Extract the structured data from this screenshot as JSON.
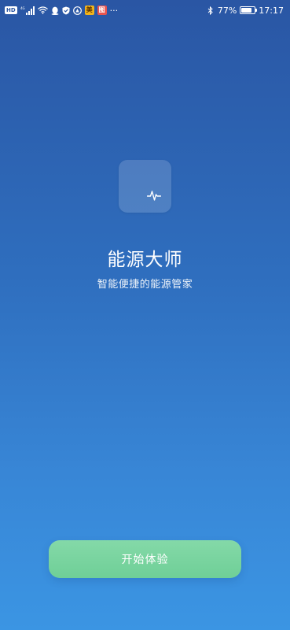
{
  "status_bar": {
    "hd_label": "HD",
    "network_label": "4G",
    "app_badge_1": "美",
    "app_badge_2": "图",
    "more_label": "···",
    "battery_percent": "77%",
    "battery_level": 0.77,
    "time": "17:17"
  },
  "app": {
    "title": "能源大师",
    "subtitle": "智能便捷的能源管家"
  },
  "actions": {
    "start_label": "开始体验"
  },
  "colors": {
    "background_top": "#2a56a4",
    "background_bottom": "#3b95e3",
    "button": "#76d39d"
  }
}
